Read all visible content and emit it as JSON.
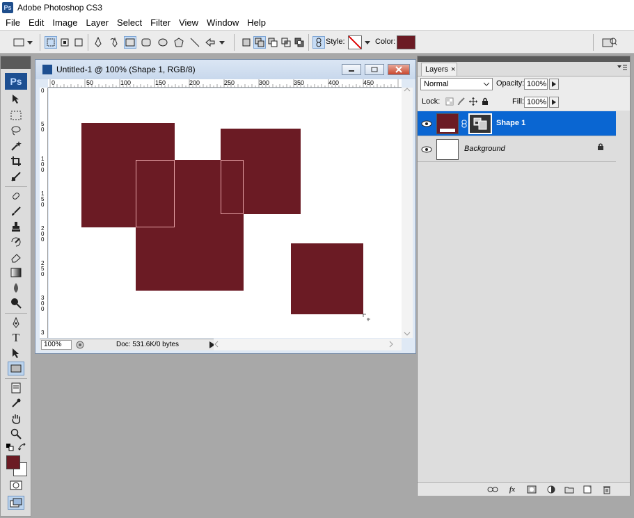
{
  "app": {
    "title": "Adobe Photoshop CS3",
    "icon_label": "Ps"
  },
  "menu": [
    "File",
    "Edit",
    "Image",
    "Layer",
    "Select",
    "Filter",
    "View",
    "Window",
    "Help"
  ],
  "options_bar": {
    "style_label": "Style:",
    "color_label": "Color:",
    "color_value": "#6b1b24"
  },
  "toolbox": {
    "logo": "Ps",
    "foreground_color": "#6b1b24",
    "background_color": "#ffffff"
  },
  "document": {
    "title": "Untitled-1 @ 100% (Shape 1, RGB/8)",
    "zoom": "100%",
    "doc_info": "Doc: 531.6K/0 bytes",
    "ruler_top_labels": [
      "0",
      "50",
      "100",
      "150",
      "200",
      "250",
      "300",
      "350",
      "400",
      "450"
    ],
    "ruler_left_labels": [
      "0",
      "5 0",
      "1 0 0",
      "1 5 0",
      "2 0 0",
      "2 5 0",
      "3 0 0",
      "3"
    ],
    "shape_color": "#6b1b24"
  },
  "layers_panel": {
    "tab_label": "Layers",
    "close_glyph": "×",
    "blend_mode": "Normal",
    "opacity_label": "Opacity:",
    "opacity_value": "100%",
    "lock_label": "Lock:",
    "fill_label": "Fill:",
    "fill_value": "100%",
    "layers": [
      {
        "name": "Shape 1",
        "selected": true
      },
      {
        "name": "Background",
        "selected": false
      }
    ]
  }
}
